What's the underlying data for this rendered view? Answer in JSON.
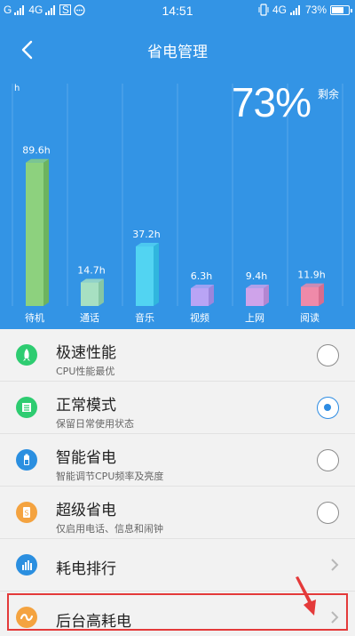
{
  "status_bar": {
    "carrier_left": "G",
    "network": "4G",
    "sim_icon": "S",
    "time": "14:51",
    "network_right": "4G",
    "battery_text": "73%",
    "battery_level": 0.73
  },
  "header": {
    "title": "省电管理"
  },
  "summary": {
    "percent": "73%",
    "percent_label": "剩余"
  },
  "chart_data": {
    "type": "bar",
    "ylabel": "h",
    "categories": [
      "待机",
      "通话",
      "音乐",
      "视频",
      "上网",
      "阅读"
    ],
    "values": [
      89.6,
      14.7,
      37.2,
      6.3,
      9.4,
      11.9
    ],
    "value_labels": [
      "89.6h",
      "14.7h",
      "37.2h",
      "6.3h",
      "9.4h",
      "11.9h"
    ],
    "colors": [
      "#8dd17e",
      "#a7e0c2",
      "#52d4f2",
      "#b9a4f5",
      "#cfa3ea",
      "#ef8aa9"
    ],
    "side_colors": [
      "#6db35f",
      "#86c6a4",
      "#30b6de",
      "#9b86dc",
      "#b386d1",
      "#d76d8e"
    ],
    "ylim": [
      0,
      100
    ],
    "grid": true
  },
  "modes": [
    {
      "name": "极速性能",
      "desc": "CPU性能最优",
      "selected": false,
      "icon": "rocket-icon",
      "color": "#2ecc71"
    },
    {
      "name": "正常模式",
      "desc": "保留日常使用状态",
      "selected": true,
      "icon": "list-icon",
      "color": "#2ecc71"
    },
    {
      "name": "智能省电",
      "desc": "智能调节CPU频率及亮度",
      "selected": false,
      "icon": "battery-icon",
      "color": "#2b8fe0"
    },
    {
      "name": "超级省电",
      "desc": "仅启用电话、信息和闹钟",
      "selected": false,
      "icon": "super-saver-icon",
      "color": "#f4a340"
    }
  ],
  "links": [
    {
      "name": "耗电排行",
      "icon": "ranking-icon",
      "color": "#2b8fe0"
    },
    {
      "name": "后台高耗电",
      "icon": "background-usage-icon",
      "color": "#f4a340"
    }
  ]
}
